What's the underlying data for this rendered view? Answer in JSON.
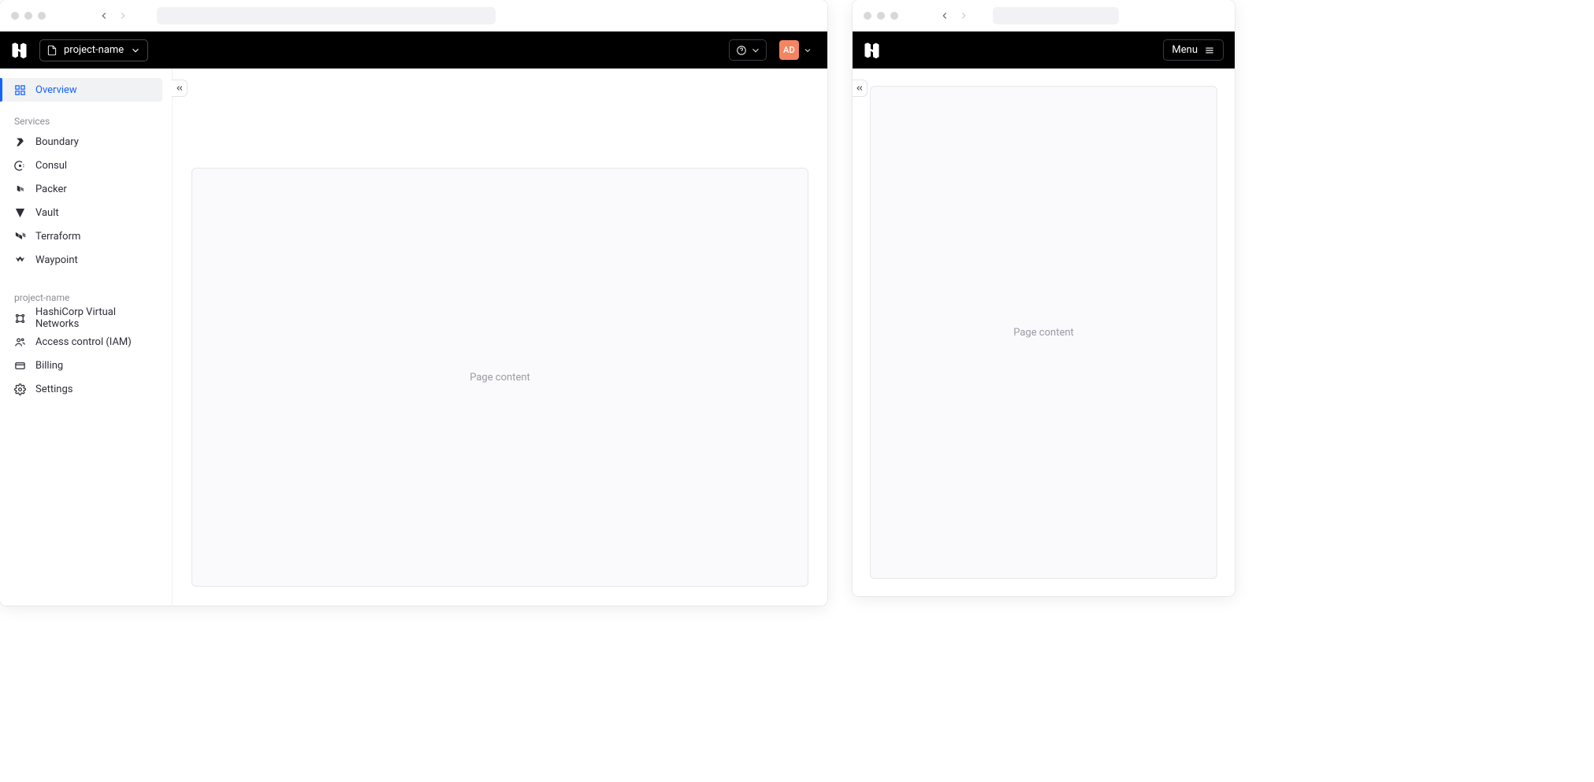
{
  "windowA": {
    "header": {
      "project_label": "project-name",
      "user_initials": "AD"
    },
    "sidebar": {
      "overview_label": "Overview",
      "services_heading": "Services",
      "services": [
        {
          "label": "Boundary"
        },
        {
          "label": "Consul"
        },
        {
          "label": "Packer"
        },
        {
          "label": "Vault"
        },
        {
          "label": "Terraform"
        },
        {
          "label": "Waypoint"
        }
      ],
      "group2_heading": "project-name",
      "group2": [
        {
          "label": "HashiCorp Virtual Networks"
        },
        {
          "label": "Access control (IAM)"
        },
        {
          "label": "Billing"
        },
        {
          "label": "Settings"
        }
      ]
    },
    "main": {
      "placeholder": "Page content"
    }
  },
  "windowB": {
    "header": {
      "menu_label": "Menu"
    },
    "main": {
      "placeholder": "Page content"
    }
  }
}
